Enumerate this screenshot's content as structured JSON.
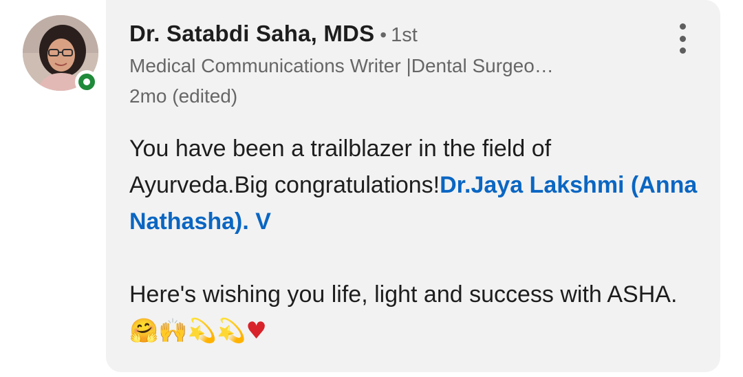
{
  "comment": {
    "author": {
      "name": "Dr. Satabdi Saha, MDS",
      "degree_separator": "•",
      "connection_degree": "1st",
      "headline": "Medical Communications Writer |Dental Surgeo…",
      "timestamp": "2mo (edited)",
      "presence_status": "online"
    },
    "menu_icon": "more-vertical-icon",
    "body": {
      "line1": "You have been a trailblazer in the field of",
      "line2_text": "Ayurveda.Big congratulations!",
      "mention": "Dr.Jaya Lakshmi (Anna Nathasha). V",
      "para2_text": "Here's wishing you life, light and success with ASHA.",
      "emojis": [
        "hugging-face",
        "raising-hands",
        "dizzy",
        "dizzy",
        "red-heart"
      ]
    },
    "colors": {
      "bubble": "#f2f2f2",
      "mention": "#0a66c2",
      "presence": "#1f8a3a",
      "secondary_text": "#666666"
    }
  }
}
